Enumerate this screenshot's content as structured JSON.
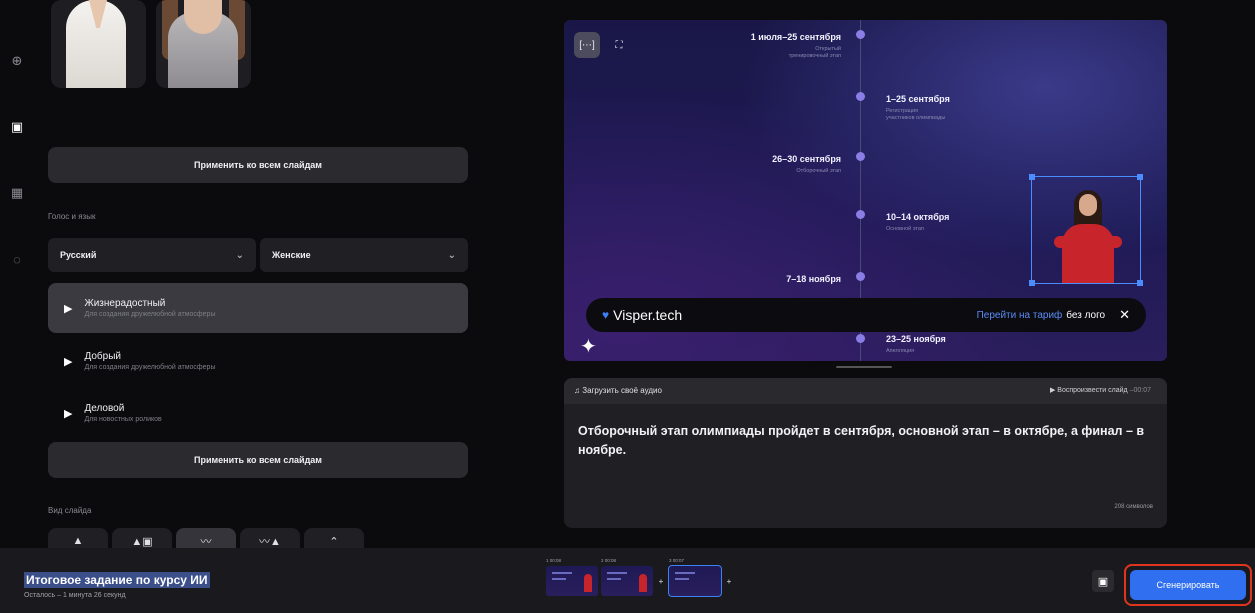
{
  "rail": {
    "items": [
      {
        "icon": "plus-circle-icon",
        "label": "",
        "active": false
      },
      {
        "icon": "person-icon",
        "label": "",
        "active": true
      },
      {
        "icon": "grid-icon",
        "label": "",
        "active": false
      },
      {
        "icon": "music-icon",
        "label": "",
        "active": false
      }
    ]
  },
  "settings": {
    "apply_all_label": "Применить ко всем слайдам",
    "voice_section_label": "Голос и язык",
    "language_value": "Русский",
    "gender_value": "Женские",
    "voices": [
      {
        "name": "Жизнерадостный",
        "desc": "Для создания дружелюбной атмосферы"
      },
      {
        "name": "Добрый",
        "desc": "Для создания дружелюбной атмосферы"
      },
      {
        "name": "Деловой",
        "desc": "Для новостных роликов"
      }
    ],
    "apply_all_label_2": "Применить ко всем слайдам",
    "slide_view_label": "Вид слайда"
  },
  "preview": {
    "timeline": [
      {
        "date": "1 июля–25 сентября",
        "sub1": "Открытый",
        "sub2": "тренировочный этап"
      },
      {
        "date": "1–25 сентября",
        "sub1": "Регистрация",
        "sub2": "участников олимпиады"
      },
      {
        "date": "26–30 сентября",
        "sub1": "Отборочный этап",
        "sub2": ""
      },
      {
        "date": "10–14 октября",
        "sub1": "Основной этап",
        "sub2": ""
      },
      {
        "date": "7–18 ноября",
        "sub1": "",
        "sub2": ""
      },
      {
        "date": "23–25 ноября",
        "sub1": "Апелляция",
        "sub2": ""
      }
    ],
    "watermark": {
      "brand": "Visper.tech",
      "link": "Перейти на тариф",
      "rest": "без лого"
    }
  },
  "editor": {
    "upload_label": "Загрузить своё аудио",
    "play_label": "Воспроизвести слайд",
    "play_duration": "–00:07",
    "script_text": "Отборочный этап олимпиады пройдет в сентября, основной этап – в октябре, а финал – в ноябре.",
    "char_count": "208 символов"
  },
  "bottombar": {
    "project_title": "Итоговое задание по курсу ИИ",
    "remaining": "Осталось – 1 минута 26 секунд",
    "film": [
      {
        "time": "1 00:08"
      },
      {
        "time": "2 00:08"
      },
      {
        "time": "3 00:07"
      }
    ],
    "generate_label": "Сгенерировать"
  }
}
